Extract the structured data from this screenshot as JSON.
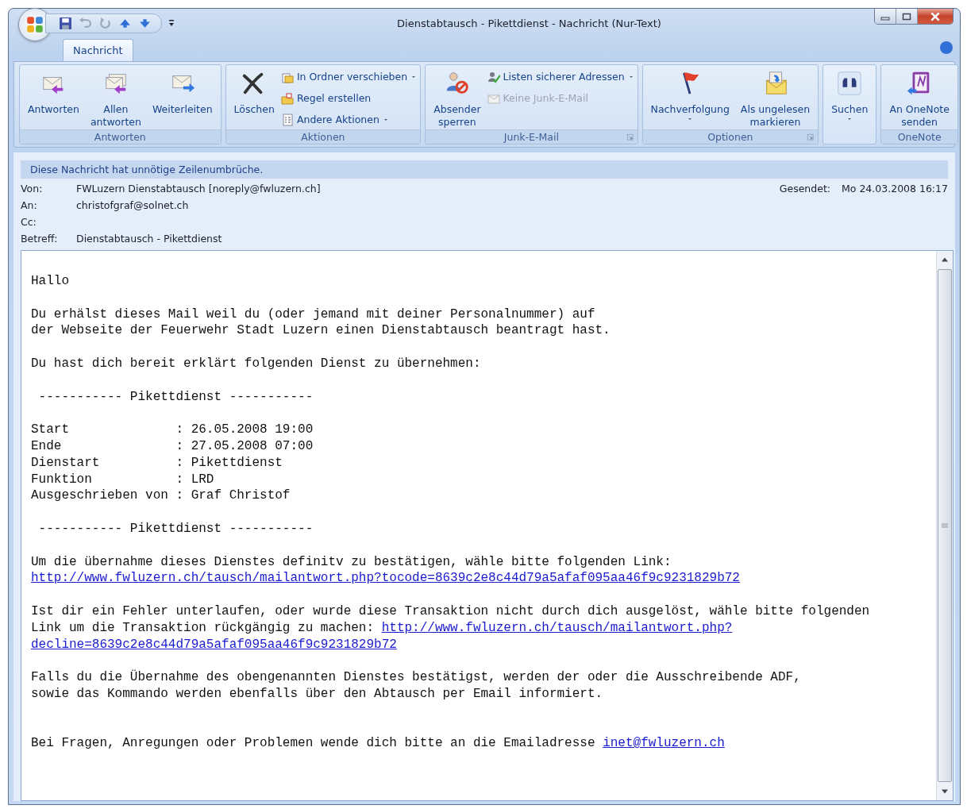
{
  "window": {
    "title": "Dienstabtausch - Pikettdienst - Nachricht (Nur-Text)"
  },
  "tabs": [
    {
      "label": "Nachricht",
      "selected": true
    }
  ],
  "ribbon": {
    "groups": [
      {
        "label": "Antworten",
        "dialog_launcher": false,
        "buttons": [
          {
            "kind": "large",
            "label": "Antworten",
            "dropdown": false,
            "disabled": false
          },
          {
            "kind": "large",
            "label": "Allen\nantworten",
            "dropdown": false,
            "disabled": false
          },
          {
            "kind": "large",
            "label": "Weiterleiten",
            "dropdown": false,
            "disabled": false
          }
        ]
      },
      {
        "label": "Aktionen",
        "dialog_launcher": false,
        "buttons": [
          {
            "kind": "large",
            "label": "Löschen",
            "dropdown": false,
            "disabled": false
          },
          {
            "kind": "small",
            "label": "In Ordner verschieben",
            "dropdown": true,
            "disabled": false
          },
          {
            "kind": "small",
            "label": "Regel erstellen",
            "dropdown": false,
            "disabled": false
          },
          {
            "kind": "small",
            "label": "Andere Aktionen",
            "dropdown": true,
            "disabled": false
          }
        ]
      },
      {
        "label": "Junk-E-Mail",
        "dialog_launcher": true,
        "buttons": [
          {
            "kind": "large",
            "label": "Absender\nsperren",
            "dropdown": false,
            "disabled": false
          },
          {
            "kind": "small",
            "label": "Listen sicherer Adressen",
            "dropdown": true,
            "disabled": false
          },
          {
            "kind": "small",
            "label": "Keine Junk-E-Mail",
            "dropdown": false,
            "disabled": true
          }
        ]
      },
      {
        "label": "Optionen",
        "dialog_launcher": true,
        "buttons": [
          {
            "kind": "large",
            "label": "Nachverfolgung",
            "dropdown": true,
            "disabled": false
          },
          {
            "kind": "large",
            "label": "Als ungelesen\nmarkieren",
            "dropdown": false,
            "disabled": false
          }
        ]
      },
      {
        "buttons": [
          {
            "kind": "large",
            "label": "Suchen",
            "dropdown": true,
            "disabled": false
          }
        ]
      },
      {
        "label": "OneNote",
        "dialog_launcher": false,
        "buttons": [
          {
            "kind": "large",
            "label": "An OneNote\nsenden",
            "dropdown": false,
            "disabled": false
          }
        ]
      }
    ]
  },
  "message": {
    "infobar": "Diese Nachricht hat unnötige Zeilenumbrüche.",
    "fields": [
      {
        "label": "Von:",
        "value": "FWLuzern Dienstabtausch [noreply@fwluzern.ch]"
      },
      {
        "label": "An:",
        "value": "christofgraf@solnet.ch"
      },
      {
        "label": "Cc:"
      },
      {
        "label": "Betreff:",
        "value": "Dienstabtausch - Pikettdienst"
      }
    ],
    "sent": {
      "label": "Gesendet:",
      "value": "Mo 24.03.2008 16:17"
    }
  },
  "body": [
    {
      "kind": "paragraph",
      "lines": [
        [
          {
            "kind": "text",
            "text": "Hallo"
          }
        ]
      ]
    },
    {
      "kind": "paragraph",
      "lines": [
        [
          {
            "kind": "text",
            "text": "Du erhälst dieses Mail weil du (oder jemand mit deiner Personalnummer) auf"
          }
        ],
        [
          {
            "kind": "text",
            "text": "der Webseite der Feuerwehr Stadt Luzern einen Dienstabtausch beantragt hast."
          }
        ]
      ]
    },
    {
      "kind": "paragraph",
      "lines": [
        [
          {
            "kind": "text",
            "text": "Du hast dich bereit erklärt folgenden Dienst zu übernehmen:"
          }
        ]
      ]
    },
    {
      "kind": "paragraph",
      "lines": [
        [
          {
            "kind": "text",
            "text": " ----------- Pikettdienst -----------"
          }
        ]
      ]
    },
    {
      "kind": "paragraph",
      "lines": [
        [
          {
            "kind": "text",
            "text": "Start              : 26.05.2008 19:00"
          }
        ],
        [
          {
            "kind": "text",
            "text": "Ende               : 27.05.2008 07:00"
          }
        ],
        [
          {
            "kind": "text",
            "text": "Dienstart          : Pikettdienst"
          }
        ],
        [
          {
            "kind": "text",
            "text": "Funktion           : LRD"
          }
        ],
        [
          {
            "kind": "text",
            "text": "Ausgeschrieben von : Graf Christof"
          }
        ]
      ]
    },
    {
      "kind": "paragraph",
      "lines": [
        [
          {
            "kind": "text",
            "text": " ----------- Pikettdienst -----------"
          }
        ]
      ]
    },
    {
      "kind": "paragraph",
      "lines": [
        [
          {
            "kind": "text",
            "text": "Um die übernahme dieses Dienstes definitv zu bestätigen, wähle bitte folgenden Link:"
          }
        ],
        [
          {
            "kind": "link",
            "text": "http://www.fwluzern.ch/tausch/mailantwort.php?tocode=8639c2e8c44d79a5afaf095aa46f9c9231829b72"
          }
        ]
      ]
    },
    {
      "kind": "paragraph",
      "lines": [
        [
          {
            "kind": "text",
            "text": "Ist dir ein Fehler unterlaufen, oder wurde diese Transaktion nicht durch dich ausgelöst, wähle bitte folgenden"
          }
        ],
        [
          {
            "kind": "text",
            "text": "Link um die Transaktion rückgängig zu machen: "
          },
          {
            "kind": "link",
            "text": "http://www.fwluzern.ch/tausch/mailantwort.php?"
          }
        ],
        [
          {
            "kind": "link",
            "text": "decline=8639c2e8c44d79a5afaf095aa46f9c9231829b72"
          }
        ]
      ]
    },
    {
      "kind": "paragraph",
      "lines": [
        [
          {
            "kind": "text",
            "text": "Falls du die Übernahme des obengenannten Dienstes bestätigst, werden der oder die Ausschreibende ADF,"
          }
        ],
        [
          {
            "kind": "text",
            "text": "sowie das Kommando werden ebenfalls über den Abtausch per Email informiert."
          }
        ]
      ]
    },
    {
      "kind": "closing",
      "lines": [
        [
          {
            "kind": "text",
            "text": "Bei Fragen, Anregungen oder Problemen wende dich bitte an die Emailadresse "
          },
          {
            "kind": "link",
            "text": "inet@fwluzern.ch"
          }
        ]
      ]
    }
  ]
}
